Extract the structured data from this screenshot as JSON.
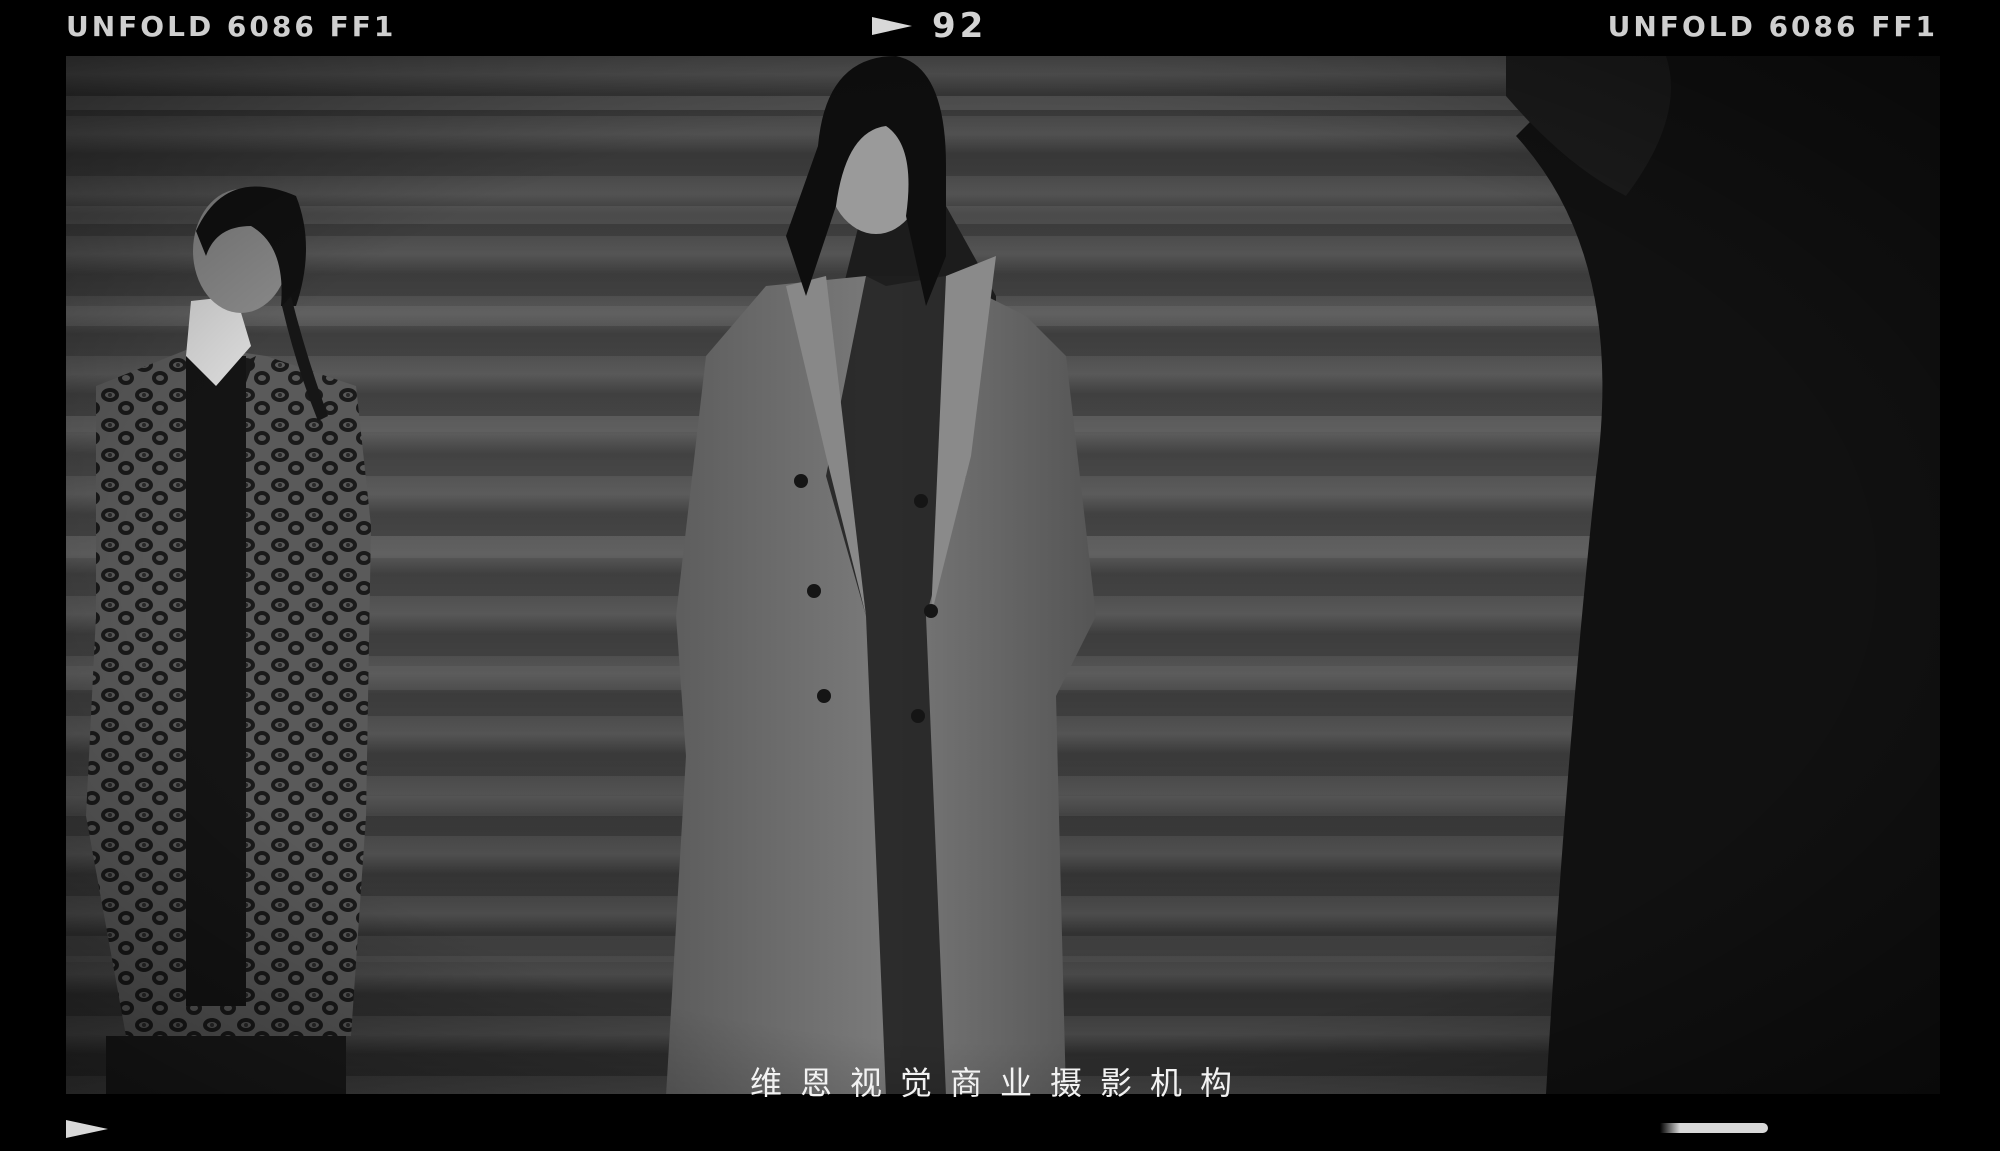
{
  "film_edge": {
    "left_label": "UNFOLD 6086 FF1",
    "right_label": "UNFOLD 6086 FF1",
    "frame_number": "92"
  },
  "caption": "维恩视觉商业摄影机构",
  "photo": {
    "description_icon": "photo-scene-icon",
    "tone": "black-and-white"
  }
}
